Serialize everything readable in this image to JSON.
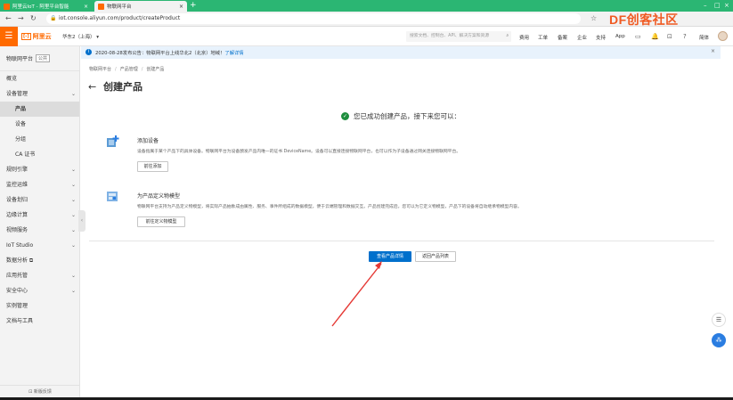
{
  "browser": {
    "tabs": [
      {
        "title": "阿里云IoT - 阿里平台智能"
      },
      {
        "title": "物联网平台"
      }
    ],
    "new_tab": "+",
    "url": "iot.console.aliyun.com/product/createProduct",
    "watermark": "DF创客社区"
  },
  "topnav": {
    "brand": "阿里云",
    "region": "华东2（上海）",
    "search_placeholder": "搜索文档、控制台、API、解决方案和资源",
    "links": [
      "费用",
      "工单",
      "备案",
      "企业",
      "支持",
      "App"
    ],
    "lang": "简体"
  },
  "sidebar": {
    "title": "物联网平台",
    "badge": "公共",
    "items": [
      {
        "label": "概览",
        "level": 0,
        "active": false,
        "chevron": false
      },
      {
        "label": "设备管理",
        "level": 0,
        "active": false,
        "chevron": true
      },
      {
        "label": "产品",
        "level": 1,
        "active": true,
        "chevron": false
      },
      {
        "label": "设备",
        "level": 1,
        "active": false,
        "chevron": false
      },
      {
        "label": "分组",
        "level": 1,
        "active": false,
        "chevron": false
      },
      {
        "label": "CA 证书",
        "level": 1,
        "active": false,
        "chevron": false
      },
      {
        "label": "规则引擎",
        "level": 0,
        "active": false,
        "chevron": true
      },
      {
        "label": "监控运维",
        "level": 0,
        "active": false,
        "chevron": true
      },
      {
        "label": "设备划归",
        "level": 0,
        "active": false,
        "chevron": true
      },
      {
        "label": "边缘计算",
        "level": 0,
        "active": false,
        "chevron": true
      },
      {
        "label": "视频服务",
        "level": 0,
        "active": false,
        "chevron": true
      },
      {
        "label": "IoT Studio",
        "level": 0,
        "active": false,
        "chevron": true
      },
      {
        "label": "数据分析 ⧉",
        "level": 0,
        "active": false,
        "chevron": false
      },
      {
        "label": "应用托管",
        "level": 0,
        "active": false,
        "chevron": true
      },
      {
        "label": "安全中心",
        "level": 0,
        "active": false,
        "chevron": true
      },
      {
        "label": "实例管理",
        "level": 0,
        "active": false,
        "chevron": false
      },
      {
        "label": "文档与工具",
        "level": 0,
        "active": false,
        "chevron": false
      }
    ],
    "footer": "新版反馈"
  },
  "notice": {
    "text": "2020-08-28发布公告：物联网平台上线华北2（北京）地域！",
    "link": "了解详情"
  },
  "breadcrumb": [
    "物联网平台",
    "产品管理",
    "创建产品"
  ],
  "page_title": "创建产品",
  "success_message": "您已成功创建产品，接下来您可以：",
  "steps": [
    {
      "title": "添加设备",
      "desc": "设备指属于某个产品下的具体设备。物联网平台为设备颁发产品内唯一的证书 DeviceName。设备可以直接连接物联网平台，也可以作为子设备通过网关连接物联网平台。",
      "button": "前往添加"
    },
    {
      "title": "为产品定义物模型",
      "desc": "物联网平台支持为产品定义物模型，将实际产品抽象成由属性、服务、事件所组成的数据模型，便于云端管理和数据交互。产品创建完成后，您可以为它定义物模型，产品下的设备将自动继承物模型内容。",
      "button": "前往定义物模型"
    }
  ],
  "actions": {
    "primary": "查看产品详情",
    "secondary": "返回产品列表"
  },
  "colors": {
    "accent": "#ff6a00",
    "primary": "#0070cc",
    "success": "#1e8e3e",
    "annotation": "#e53935"
  }
}
